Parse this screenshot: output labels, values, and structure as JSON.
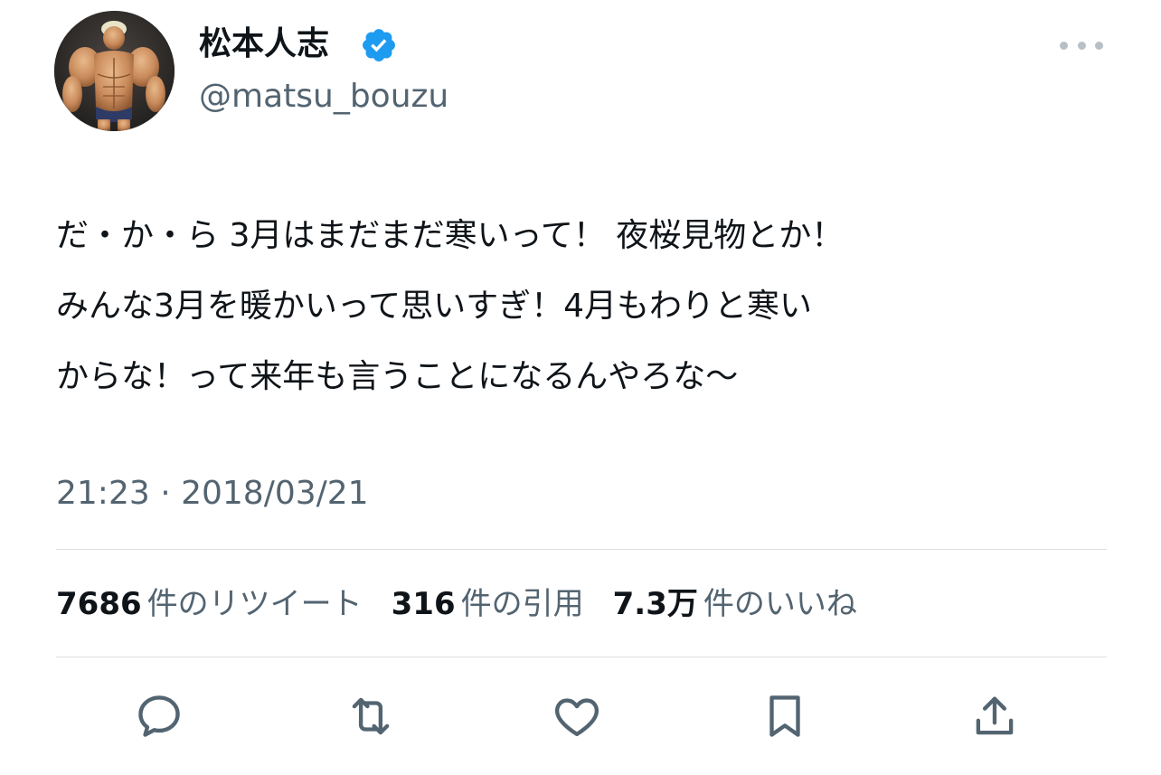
{
  "tweet": {
    "author": {
      "display_name": "松本人志",
      "handle": "@matsu_bouzu",
      "verified": true,
      "verified_color": "#1d9bf0"
    },
    "text_lines": [
      "だ・か・ら 3月はまだまだ寒いって！ 夜桜見物とか！",
      "みんな3月を暖かいって思いすぎ！4月もわりと寒い",
      "からな！って来年も言うことになるんやろな〜"
    ],
    "timestamp": "21:23 · 2018/03/21",
    "stats": {
      "retweets": {
        "count": "7686",
        "label": "件のリツイート"
      },
      "quotes": {
        "count": "316",
        "label": "件の引用"
      },
      "likes": {
        "count": "7.3万",
        "label": "件のいいね"
      }
    },
    "actions": [
      "reply-icon",
      "retweet-icon",
      "like-icon",
      "bookmark-icon",
      "share-icon"
    ]
  },
  "colors": {
    "text": "#0f1419",
    "secondary": "#536471",
    "icon": "#536471",
    "divider": "#dbe0e4"
  }
}
